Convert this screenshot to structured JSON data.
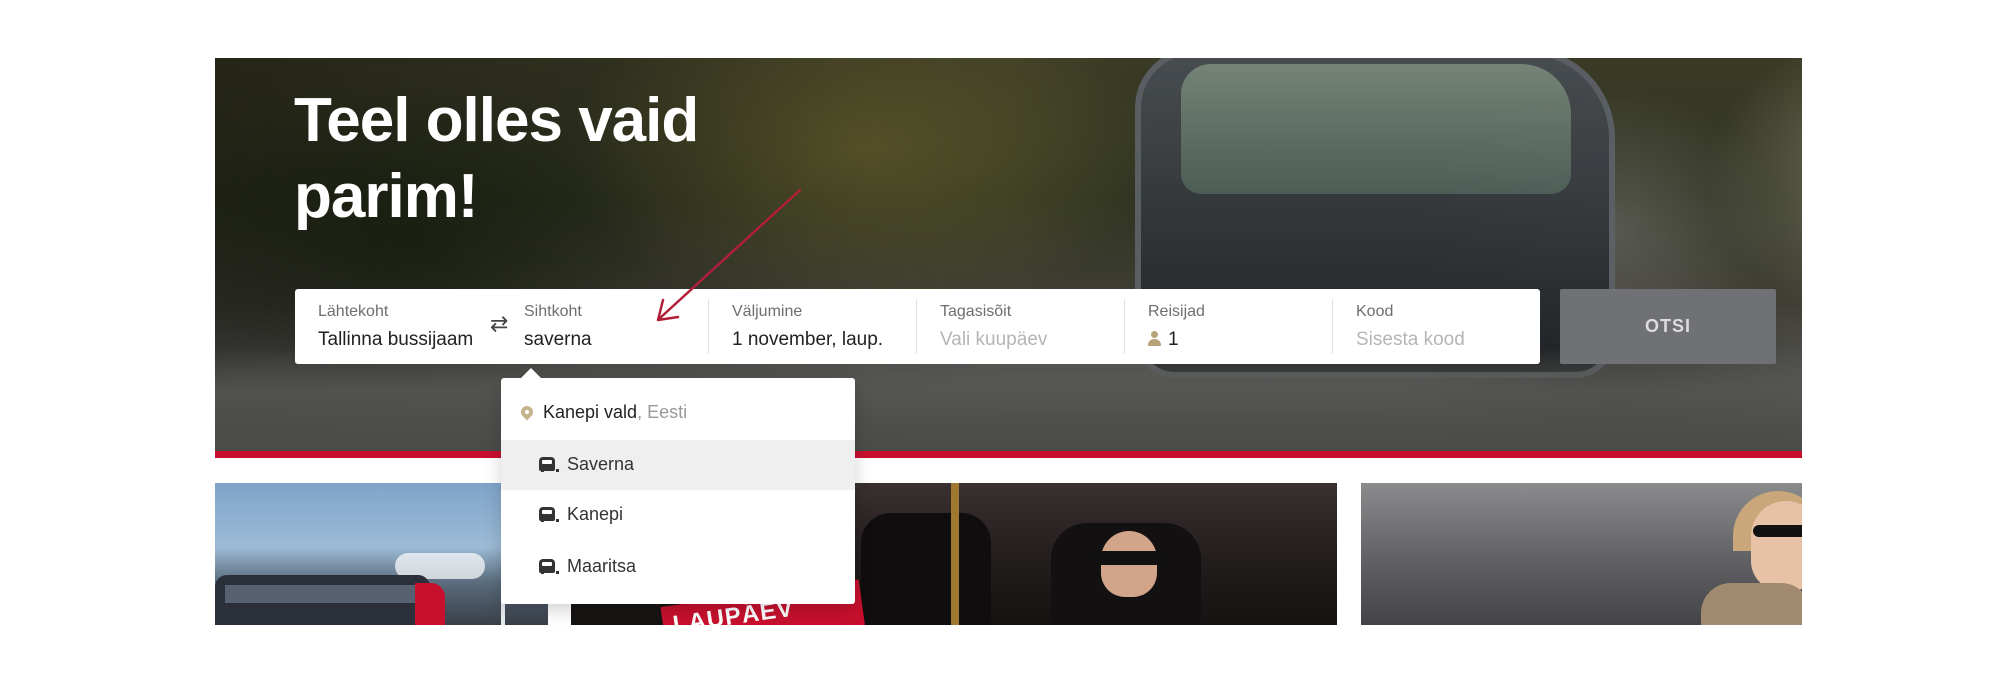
{
  "hero": {
    "title": "Teel olles vaid\nparim!"
  },
  "search": {
    "from": {
      "label": "Lähtekoht",
      "value": "Tallinna bussijaam"
    },
    "swap_icon": "swap-arrows",
    "to": {
      "label": "Sihtkoht",
      "value": "saverna"
    },
    "departure": {
      "label": "Väljumine",
      "value": "1 november, laup."
    },
    "return": {
      "label": "Tagasisõit",
      "placeholder": "Vali kuupäev"
    },
    "passengers": {
      "label": "Reisijad",
      "value": "1",
      "icon": "person"
    },
    "code": {
      "label": "Kood",
      "placeholder": "Sisesta kood"
    },
    "submit_label": "OTSI"
  },
  "dropdown": {
    "group": {
      "name": "Kanepi vald",
      "country": ", Eesti",
      "icon": "location-pin"
    },
    "items": [
      {
        "label": "Saverna",
        "icon": "bus",
        "active": true
      },
      {
        "label": "Kanepi",
        "icon": "bus",
        "active": false
      },
      {
        "label": "Maaritsa",
        "icon": "bus",
        "active": false
      }
    ]
  },
  "cards": {
    "card2_tag": "LAUPÄEV"
  },
  "colors": {
    "accent_red": "#c8102e",
    "button_grey": "#6f7174",
    "annotation_arrow": "#b01e3a"
  }
}
